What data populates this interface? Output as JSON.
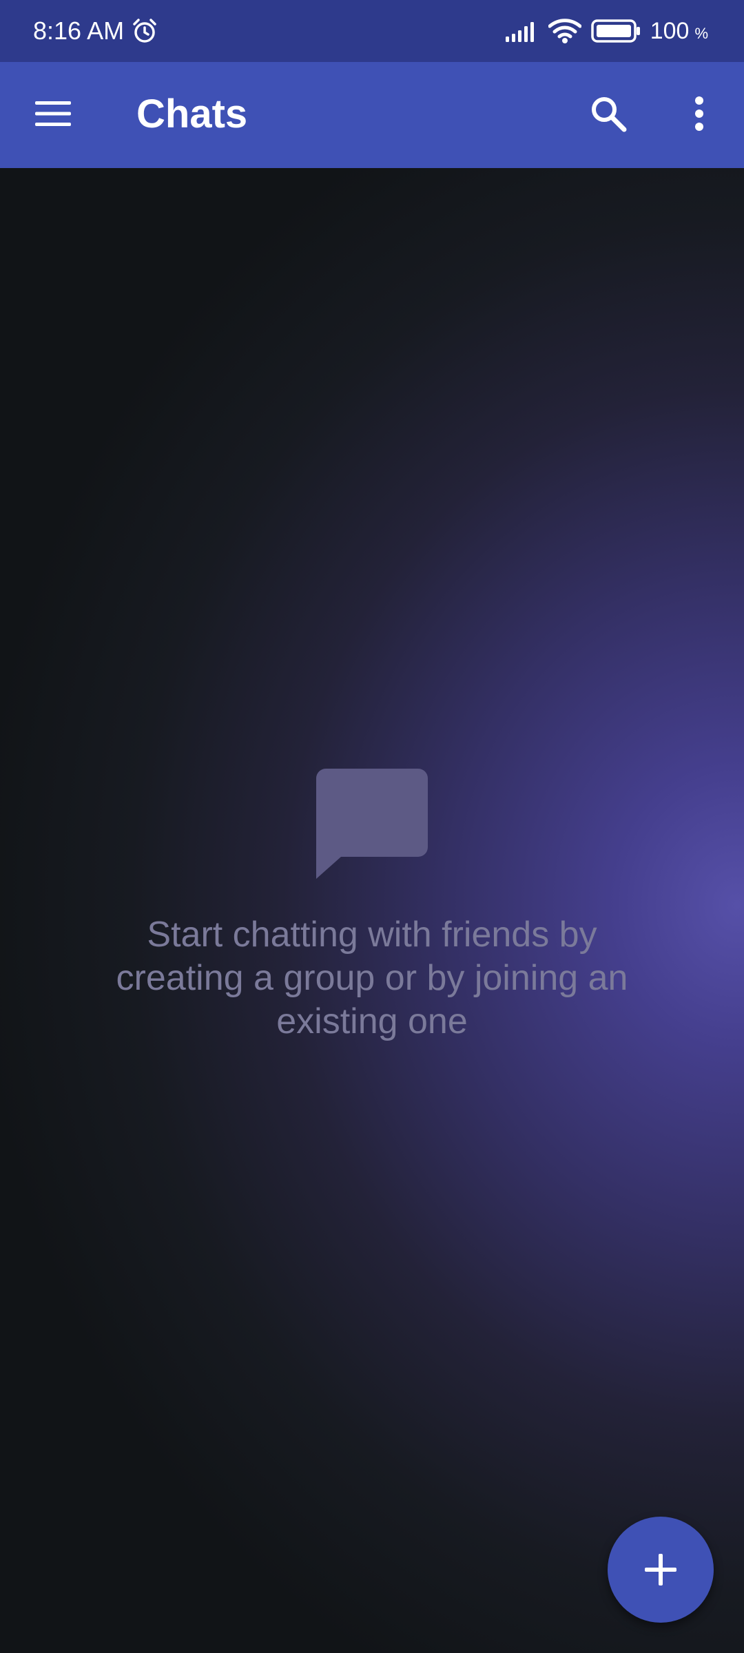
{
  "status_bar": {
    "time": "8:16 AM",
    "alarm_icon": "alarm-clock-icon",
    "signal_icon": "cellular-signal-icon",
    "wifi_icon": "wifi-icon",
    "battery_icon": "battery-icon",
    "battery_level": "100",
    "battery_unit": "%"
  },
  "app_bar": {
    "title": "Chats",
    "menu_icon": "hamburger-menu-icon",
    "search_icon": "search-icon",
    "more_icon": "more-vertical-icon",
    "background_color": "#3f51b5"
  },
  "empty_state": {
    "icon": "chat-bubble-icon",
    "message": "Start chatting with friends by creating a group or by joining an existing one"
  },
  "fab": {
    "icon": "plus-icon",
    "color": "#3f51b5"
  }
}
